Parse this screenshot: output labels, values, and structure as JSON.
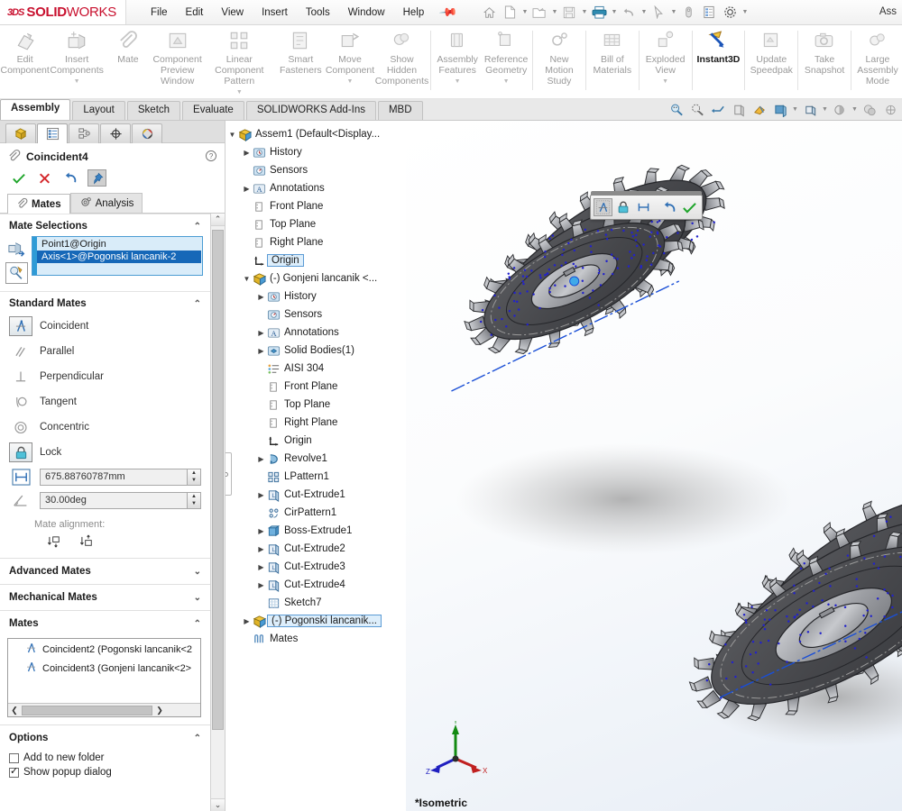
{
  "app": {
    "brand_ds": "3DS",
    "brand_name_bold": "SOLID",
    "brand_name_light": "WORKS",
    "title_right": "Ass"
  },
  "menubar": {
    "items": [
      "File",
      "Edit",
      "View",
      "Insert",
      "Tools",
      "Window",
      "Help"
    ],
    "pin_icon": "pushpin-icon",
    "quick_tools": [
      "home-icon",
      "new-document-icon",
      "open-folder-icon",
      "save-icon",
      "print-icon",
      "undo-icon",
      "select-cursor-icon",
      "rebuild-icon",
      "options-gear-icon"
    ]
  },
  "ribbon": {
    "items": [
      {
        "label": "Edit\nComponent",
        "icon": "edit-component-icon",
        "caret": false,
        "active": false
      },
      {
        "label": "Insert\nComponents",
        "icon": "insert-components-icon",
        "caret": true,
        "active": false
      },
      {
        "label": "Mate",
        "icon": "mate-paperclip-icon",
        "caret": false,
        "active": false
      },
      {
        "label": "Component\nPreview\nWindow",
        "icon": "component-preview-icon",
        "caret": false,
        "active": false
      },
      {
        "label": "Linear Component\nPattern",
        "icon": "linear-pattern-icon",
        "caret": true,
        "active": false
      },
      {
        "label": "Smart\nFasteners",
        "icon": "smart-fasteners-icon",
        "caret": false,
        "active": false
      },
      {
        "label": "Move\nComponent",
        "icon": "move-component-icon",
        "caret": true,
        "active": false
      },
      {
        "label": "Show\nHidden\nComponents",
        "icon": "show-hidden-icon",
        "caret": false,
        "active": false
      },
      {
        "label": "Assembly\nFeatures",
        "icon": "assembly-features-icon",
        "caret": true,
        "active": false
      },
      {
        "label": "Reference\nGeometry",
        "icon": "reference-geometry-icon",
        "caret": true,
        "active": false
      },
      {
        "label": "New\nMotion\nStudy",
        "icon": "motion-study-icon",
        "caret": false,
        "active": false
      },
      {
        "label": "Bill of\nMaterials",
        "icon": "bom-icon",
        "caret": false,
        "active": false
      },
      {
        "label": "Exploded\nView",
        "icon": "exploded-view-icon",
        "caret": true,
        "active": false
      },
      {
        "label": "Instant3D",
        "icon": "instant3d-icon",
        "caret": false,
        "active": true
      },
      {
        "label": "Update\nSpeedpak",
        "icon": "update-speedpak-icon",
        "caret": false,
        "active": false
      },
      {
        "label": "Take\nSnapshot",
        "icon": "take-snapshot-icon",
        "caret": false,
        "active": false
      },
      {
        "label": "Large\nAssembly\nMode",
        "icon": "large-assembly-icon",
        "caret": false,
        "active": false
      }
    ]
  },
  "tabs": {
    "items": [
      "Assembly",
      "Layout",
      "Sketch",
      "Evaluate",
      "SOLIDWORKS Add-Ins",
      "MBD"
    ],
    "selected": "Assembly",
    "view_tools": [
      "zoom-to-fit-icon",
      "zoom-to-area-icon",
      "previous-view-icon",
      "section-view-icon",
      "view-orientation-icon",
      "display-style-icon",
      "hide-show-icon",
      "apply-scene-icon",
      "view-settings-icon"
    ]
  },
  "property_manager": {
    "tabs": [
      "feature-tree-tab",
      "property-manager-tab",
      "configuration-manager-tab",
      "dimxpert-tab",
      "appearances-tab"
    ],
    "selected_tab_index": 1,
    "title": "Coincident4",
    "title_icon": "mate-paperclip-icon",
    "help_icon": "help-question-icon",
    "actions": [
      "ok-check-icon",
      "cancel-x-icon",
      "undo-arrow-icon",
      "keep-visible-pin-icon"
    ],
    "subtabs": [
      {
        "label": "Mates",
        "icon": "mates-paperclip-icon",
        "selected": true
      },
      {
        "label": "Analysis",
        "icon": "analysis-gear-icon",
        "selected": false
      }
    ],
    "mate_selections": {
      "header": "Mate Selections",
      "side_icons": [
        "selection-entities-icon",
        "multiple-mate-mode-icon"
      ],
      "items": [
        {
          "text": "Point1@Origin",
          "highlighted": false
        },
        {
          "text": "Axis<1>@Pogonski lancanik-2",
          "highlighted": true
        }
      ]
    },
    "standard_mates": {
      "header": "Standard Mates",
      "options": [
        {
          "label": "Coincident",
          "icon": "coincident-icon",
          "selected": true
        },
        {
          "label": "Parallel",
          "icon": "parallel-icon",
          "selected": false
        },
        {
          "label": "Perpendicular",
          "icon": "perpendicular-icon",
          "selected": false
        },
        {
          "label": "Tangent",
          "icon": "tangent-icon",
          "selected": false
        },
        {
          "label": "Concentric",
          "icon": "concentric-icon",
          "selected": false
        },
        {
          "label": "Lock",
          "icon": "lock-icon",
          "selected": true
        }
      ],
      "distance_value": "675.88760787mm",
      "distance_icon": "distance-mate-icon",
      "angle_value": "30.00deg",
      "angle_icon": "angle-mate-icon",
      "alignment_label": "Mate alignment:",
      "alignment_buttons": [
        "aligned-icon",
        "anti-aligned-icon"
      ]
    },
    "advanced_mates": {
      "header": "Advanced Mates",
      "expanded": false
    },
    "mechanical_mates": {
      "header": "Mechanical Mates",
      "expanded": false
    },
    "mates": {
      "header": "Mates",
      "items": [
        "Coincident2 (Pogonski lancanik<2",
        "Coincident3 (Gonjeni lancanik<2>"
      ]
    },
    "options": {
      "header": "Options",
      "items": [
        {
          "label": "Add to new folder",
          "checked": false
        },
        {
          "label": "Show popup dialog",
          "checked": true
        }
      ]
    }
  },
  "feature_tree": {
    "nodes": [
      {
        "depth": 0,
        "label": "Assem1  (Default<Display...",
        "icon": "assembly-icon",
        "arrow": "down",
        "selected": false
      },
      {
        "depth": 1,
        "label": "History",
        "icon": "history-icon",
        "arrow": "right",
        "selected": false
      },
      {
        "depth": 1,
        "label": "Sensors",
        "icon": "sensors-icon",
        "arrow": "none",
        "selected": false
      },
      {
        "depth": 1,
        "label": "Annotations",
        "icon": "annotations-icon",
        "arrow": "right",
        "selected": false
      },
      {
        "depth": 1,
        "label": "Front Plane",
        "icon": "plane-icon",
        "arrow": "none",
        "selected": false
      },
      {
        "depth": 1,
        "label": "Top Plane",
        "icon": "plane-icon",
        "arrow": "none",
        "selected": false
      },
      {
        "depth": 1,
        "label": "Right Plane",
        "icon": "plane-icon",
        "arrow": "none",
        "selected": false
      },
      {
        "depth": 1,
        "label": "Origin",
        "icon": "origin-icon",
        "arrow": "none",
        "selected": true
      },
      {
        "depth": 1,
        "label": "(-) Gonjeni lancanik <...",
        "icon": "part-icon",
        "arrow": "down",
        "selected": false
      },
      {
        "depth": 2,
        "label": "History",
        "icon": "history-icon",
        "arrow": "right",
        "selected": false
      },
      {
        "depth": 2,
        "label": "Sensors",
        "icon": "sensors-icon",
        "arrow": "none",
        "selected": false
      },
      {
        "depth": 2,
        "label": "Annotations",
        "icon": "annotations-icon",
        "arrow": "right",
        "selected": false
      },
      {
        "depth": 2,
        "label": "Solid Bodies(1)",
        "icon": "solid-bodies-icon",
        "arrow": "right",
        "selected": false
      },
      {
        "depth": 2,
        "label": "AISI 304",
        "icon": "material-icon",
        "arrow": "none",
        "selected": false
      },
      {
        "depth": 2,
        "label": "Front Plane",
        "icon": "plane-icon",
        "arrow": "none",
        "selected": false
      },
      {
        "depth": 2,
        "label": "Top Plane",
        "icon": "plane-icon",
        "arrow": "none",
        "selected": false
      },
      {
        "depth": 2,
        "label": "Right Plane",
        "icon": "plane-icon",
        "arrow": "none",
        "selected": false
      },
      {
        "depth": 2,
        "label": "Origin",
        "icon": "origin-icon",
        "arrow": "none",
        "selected": false
      },
      {
        "depth": 2,
        "label": "Revolve1",
        "icon": "revolve-icon",
        "arrow": "right",
        "selected": false
      },
      {
        "depth": 2,
        "label": "LPattern1",
        "icon": "lpattern-icon",
        "arrow": "none",
        "selected": false
      },
      {
        "depth": 2,
        "label": "Cut-Extrude1",
        "icon": "cut-extrude-icon",
        "arrow": "right",
        "selected": false
      },
      {
        "depth": 2,
        "label": "CirPattern1",
        "icon": "cirpattern-icon",
        "arrow": "none",
        "selected": false
      },
      {
        "depth": 2,
        "label": "Boss-Extrude1",
        "icon": "boss-extrude-icon",
        "arrow": "right",
        "selected": false
      },
      {
        "depth": 2,
        "label": "Cut-Extrude2",
        "icon": "cut-extrude-icon",
        "arrow": "right",
        "selected": false
      },
      {
        "depth": 2,
        "label": "Cut-Extrude3",
        "icon": "cut-extrude-icon",
        "arrow": "right",
        "selected": false
      },
      {
        "depth": 2,
        "label": "Cut-Extrude4",
        "icon": "cut-extrude-icon",
        "arrow": "right",
        "selected": false
      },
      {
        "depth": 2,
        "label": "Sketch7",
        "icon": "sketch-icon",
        "arrow": "none",
        "selected": false
      },
      {
        "depth": 1,
        "label": "(-) Pogonski lancanik...",
        "icon": "part-icon",
        "arrow": "right",
        "selected": true
      },
      {
        "depth": 1,
        "label": "Mates",
        "icon": "mates-folder-icon",
        "arrow": "none",
        "selected": false
      }
    ]
  },
  "graphics": {
    "context_toolbar": {
      "buttons": [
        "coincident-mate-icon",
        "lock-mate-icon",
        "distance-mate-icon",
        "undo-icon",
        "ok-check-icon"
      ]
    },
    "view_label": "*Isometric",
    "triad": {
      "x": "X",
      "y": "Y",
      "z": "Z"
    },
    "colors": {
      "model_body": "#4d4e52",
      "model_teeth": "#aeb0b4",
      "sketch_point": "#2222cc",
      "axis_line": "#1a4fd6",
      "accent": "#1668b8"
    }
  }
}
